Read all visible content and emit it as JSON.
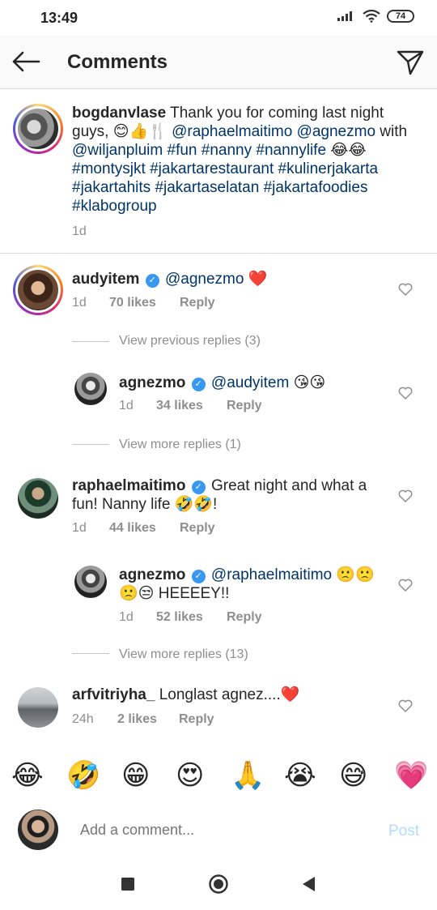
{
  "status": {
    "time": "13:49",
    "battery": "74"
  },
  "header": {
    "title": "Comments"
  },
  "caption": {
    "user": "bogdanvlase",
    "text_segments": [
      {
        "t": " Thank you for coming last night guys, 😊👍🍴 ",
        "k": "text"
      },
      {
        "t": "@raphaelmaitimo",
        "k": "tag"
      },
      {
        "t": " ",
        "k": "text"
      },
      {
        "t": "@agnezmo",
        "k": "tag"
      },
      {
        "t": " with ",
        "k": "text"
      },
      {
        "t": "@wiljanpluim",
        "k": "tag"
      },
      {
        "t": " ",
        "k": "text"
      },
      {
        "t": "#fun",
        "k": "tag"
      },
      {
        "t": " ",
        "k": "text"
      },
      {
        "t": "#nanny",
        "k": "tag"
      },
      {
        "t": " ",
        "k": "text"
      },
      {
        "t": "#nannylife",
        "k": "tag"
      },
      {
        "t": " 😂😂 ",
        "k": "text"
      },
      {
        "t": "#montysjkt",
        "k": "tag"
      },
      {
        "t": " ",
        "k": "text"
      },
      {
        "t": "#jakartarestaurant",
        "k": "tag"
      },
      {
        "t": " ",
        "k": "text"
      },
      {
        "t": "#kulinerjakarta",
        "k": "tag"
      },
      {
        "t": " ",
        "k": "text"
      },
      {
        "t": "#jakartahits",
        "k": "tag"
      },
      {
        "t": " ",
        "k": "text"
      },
      {
        "t": "#jakartaselatan",
        "k": "tag"
      },
      {
        "t": " ",
        "k": "text"
      },
      {
        "t": "#jakartafoodies",
        "k": "tag"
      },
      {
        "t": " ",
        "k": "text"
      },
      {
        "t": "#klabogroup",
        "k": "tag"
      }
    ],
    "time": "1d"
  },
  "comments": [
    {
      "user": "audyitem",
      "mention": "@agnezmo",
      "text": " ❤️",
      "time": "1d",
      "likes": "70 likes",
      "reply": "Reply"
    },
    {
      "user": "agnezmo",
      "mention": "@audyitem",
      "text": " 😘😘",
      "time": "1d",
      "likes": "34 likes",
      "reply": "Reply"
    },
    {
      "user": "raphaelmaitimo",
      "text1": " Great night and what a",
      "text2": "fun! Nanny life 🤣🤣!",
      "time": "1d",
      "likes": "44 likes",
      "reply": "Reply"
    },
    {
      "user": "agnezmo",
      "mention": "@raphaelmaitimo",
      "text1": " 🙁🙁",
      "text2": "🙁😒 HEEEEY!!",
      "time": "1d",
      "likes": "52 likes",
      "reply": "Reply"
    },
    {
      "user": "arfvitriyha_",
      "text": " Longlast agnez....❤️",
      "time": "24h",
      "likes": "2 likes",
      "reply": "Reply"
    }
  ],
  "view_replies": {
    "previous": "View previous replies (3)",
    "more1": "View more replies (1)",
    "more2": "View more replies (13)"
  },
  "emoji_bar": [
    "😂",
    "🤣",
    "😁",
    "😍",
    "🙏",
    "😭",
    "😅",
    "💗"
  ],
  "compose": {
    "placeholder": "Add a comment...",
    "post": "Post"
  }
}
